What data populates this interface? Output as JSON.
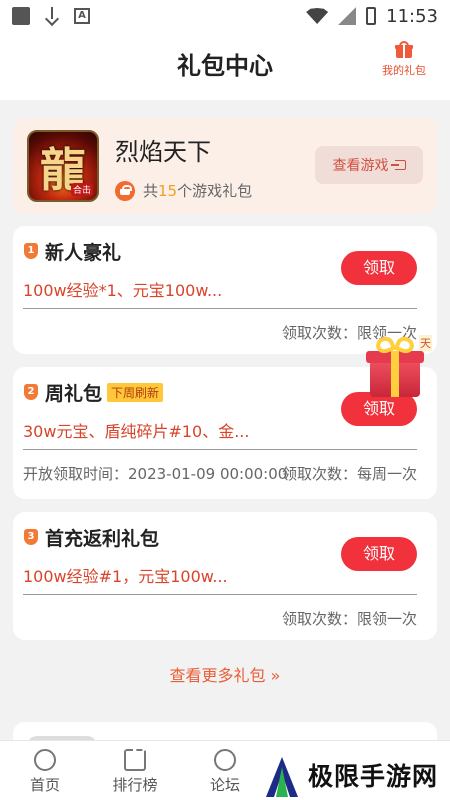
{
  "status_bar": {
    "time": "11:53"
  },
  "header": {
    "title": "礼包中心",
    "my_gifts_label": "我的礼包"
  },
  "game": {
    "name": "烈焰天下",
    "icon_char": "龍",
    "icon_tag": "合击",
    "count_prefix": "共",
    "count": "15",
    "count_suffix": "个游戏礼包",
    "view_button": "查看游戏"
  },
  "packs": [
    {
      "rank": "1",
      "title": "新人豪礼",
      "tag": "",
      "desc": "100w经验*1、元宝100w...",
      "button": "领取",
      "open_time": "",
      "limit": "领取次数：限领一次"
    },
    {
      "rank": "2",
      "title": "周礼包",
      "tag": "下周刷新",
      "desc": "30w元宝、盾纯碎片#10、金...",
      "button": "领取",
      "open_time": "开放领取时间：2023-01-09 00:00:00",
      "limit": "领取次数：每周一次"
    },
    {
      "rank": "3",
      "title": "首充返利礼包",
      "tag": "",
      "desc": "100w经验#1，元宝100w...",
      "button": "领取",
      "open_time": "",
      "limit": "领取次数：限领一次"
    }
  ],
  "float_gift": {
    "tag": "天"
  },
  "more_link": "查看更多礼包 »",
  "bottom_nav": [
    {
      "label": "首页"
    },
    {
      "label": "排行榜"
    },
    {
      "label": "论坛"
    }
  ],
  "watermark": {
    "text": "极限手游网"
  }
}
